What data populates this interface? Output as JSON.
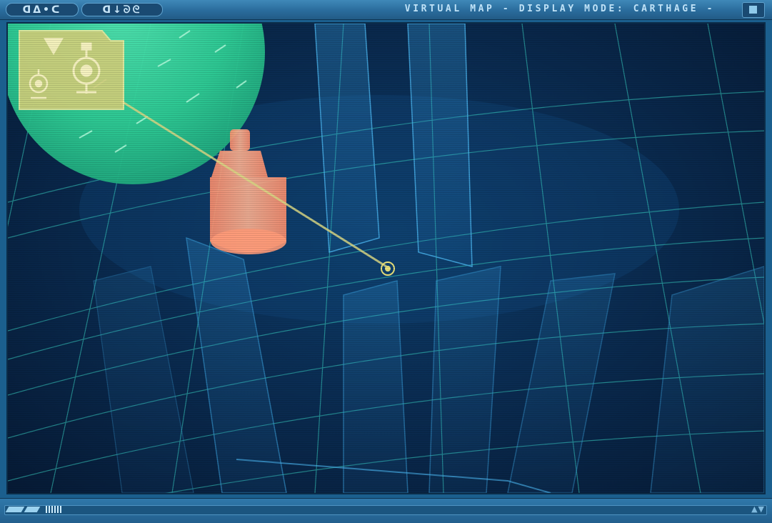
{
  "window": {
    "title": "VIRTUAL MAP - DISPLAY MODE: CARTHAGE -",
    "glyph_group_left": "ᗡᐃ•ᑕ",
    "glyph_group_right": "ᗡ↓ᘐᘓ"
  },
  "icons": {
    "window_control": "maximize-square-icon",
    "tower_marker": "tower-target-icon",
    "target_marker": "target-ring-icon",
    "scroll": "scroll-arrows-icon"
  },
  "colors": {
    "frame": "#2a6c9c",
    "grid": "#3fd6c6",
    "sector_sphere": "#2fd39a",
    "tower_hologram": "#ff9f78",
    "info_panel": "#d8d07a",
    "target_marker": "#e8e07a"
  },
  "bottom_bar": {
    "arrows": "▲▼"
  }
}
